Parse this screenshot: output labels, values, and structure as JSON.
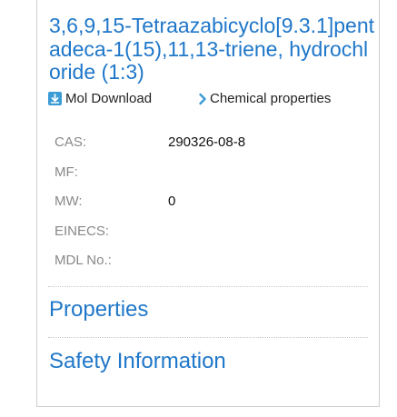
{
  "compound": {
    "title": "3,6,9,15-Tetraazabicyclo[9.3.1]pentadeca-1(15),11,13-triene, hydrochloride (1:3)"
  },
  "links": {
    "mol_download": "Mol Download",
    "chemical_properties": "Chemical properties"
  },
  "properties": [
    {
      "label": "CAS:",
      "value": "290326-08-8"
    },
    {
      "label": "MF:",
      "value": ""
    },
    {
      "label": "MW:",
      "value": "0"
    },
    {
      "label": "EINECS:",
      "value": ""
    },
    {
      "label": "MDL No.:",
      "value": ""
    }
  ],
  "sections": {
    "properties": "Properties",
    "safety": "Safety Information"
  },
  "colors": {
    "accent": "#1f77c9",
    "icon_blue": "#3a9bd5",
    "label_gray": "#888888"
  }
}
